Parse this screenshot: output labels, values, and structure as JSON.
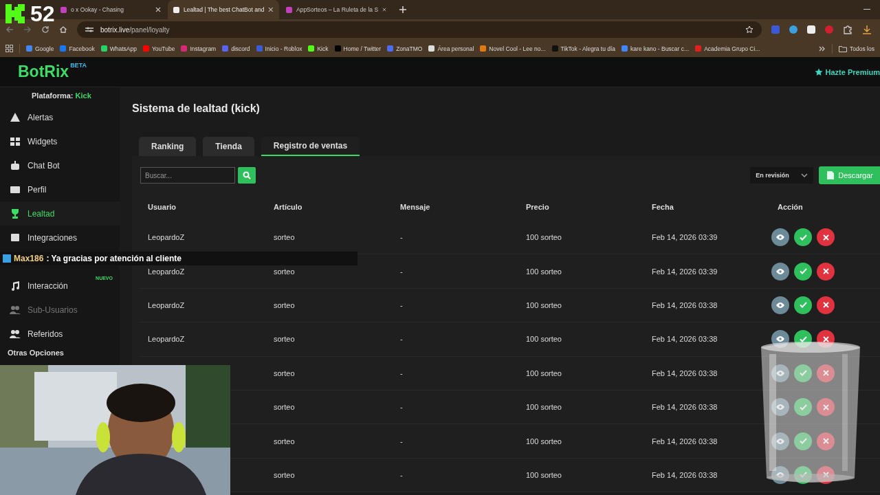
{
  "stream_overlay": {
    "counter": "52"
  },
  "browser": {
    "tabs": [
      {
        "title": "o x Ookay - Chasing",
        "selected": false
      },
      {
        "title": "Lealtad | The best ChatBot and",
        "selected": true
      },
      {
        "title": "AppSorteos – La Ruleta de la S",
        "selected": false
      }
    ],
    "url_host": "botrix.live",
    "url_path": "/panel/loyalty",
    "bookmarks": [
      "Google",
      "Facebook",
      "WhatsApp",
      "YouTube",
      "Instagram",
      "discord",
      "Inicio - Roblox",
      "Kick",
      "Home / Twitter",
      "ZonaTMO",
      "Área personal",
      "Novel Cool - Lee no...",
      "TikTok - Alegra tu día",
      "kare kano - Buscar c...",
      "Academia Grupo Ci..."
    ],
    "all_bookmarks": "Todos los"
  },
  "header": {
    "logo": "BotRix",
    "badge": "BETA",
    "premium": "Hazte Premium"
  },
  "sidebar": {
    "platform_label": "Plataforma:",
    "platform": "Kick",
    "items": [
      {
        "label": "Alertas",
        "kind": "warning",
        "selected": false,
        "disabled": false
      },
      {
        "label": "Widgets",
        "kind": "grid",
        "selected": false,
        "disabled": false
      },
      {
        "label": "Chat Bot",
        "kind": "robot",
        "selected": false,
        "disabled": false
      },
      {
        "label": "Perfil",
        "kind": "card",
        "selected": false,
        "disabled": false
      },
      {
        "label": "Lealtad",
        "kind": "trophy",
        "selected": true,
        "disabled": false
      },
      {
        "label": "Integraciones",
        "kind": "plug",
        "selected": false,
        "disabled": false
      },
      {
        "kind": "covered"
      },
      {
        "label": "Interacción",
        "kind": "music",
        "selected": false,
        "disabled": false,
        "badge": "NUEVO"
      },
      {
        "label": "Sub-Usuarios",
        "kind": "users",
        "selected": false,
        "disabled": true
      },
      {
        "label": "Referidos",
        "kind": "users",
        "selected": false,
        "disabled": false
      }
    ],
    "section": "Otras Opciones"
  },
  "main": {
    "title": "Sistema de lealtad (kick)",
    "tabs": [
      {
        "label": "Ranking",
        "selected": false
      },
      {
        "label": "Tienda",
        "selected": false
      },
      {
        "label": "Registro de ventas",
        "selected": true
      }
    ],
    "search": {
      "placeholder": "Buscar..."
    },
    "status_filter": "En revisión",
    "download_button": "Descargar",
    "table": {
      "columns": [
        "Usuario",
        "Artículo",
        "Mensaje",
        "Precio",
        "Fecha",
        "Acción"
      ],
      "rows": [
        {
          "user": "LeopardoZ",
          "item": "sorteo",
          "message": "-",
          "price": "100 sorteo",
          "date": "Feb 14, 2026 03:39"
        },
        {
          "user": "LeopardoZ",
          "item": "sorteo",
          "message": "-",
          "price": "100 sorteo",
          "date": "Feb 14, 2026 03:39"
        },
        {
          "user": "LeopardoZ",
          "item": "sorteo",
          "message": "-",
          "price": "100 sorteo",
          "date": "Feb 14, 2026 03:38"
        },
        {
          "user": "LeopardoZ",
          "item": "sorteo",
          "message": "-",
          "price": "100 sorteo",
          "date": "Feb 14, 2026 03:38"
        },
        {
          "item": "sorteo",
          "message": "-",
          "price": "100 sorteo",
          "date": "Feb 14, 2026 03:38"
        },
        {
          "item": "sorteo",
          "message": "-",
          "price": "100 sorteo",
          "date": "Feb 14, 2026 03:38"
        },
        {
          "item": "sorteo",
          "message": "-",
          "price": "100 sorteo",
          "date": "Feb 14, 2026 03:38"
        },
        {
          "item": "sorteo",
          "message": "-",
          "price": "100 sorteo",
          "date": "Feb 14, 2026 03:38"
        }
      ]
    }
  },
  "chat_message": {
    "author": "Max186",
    "text": ": Ya gracias por atención al cliente"
  }
}
